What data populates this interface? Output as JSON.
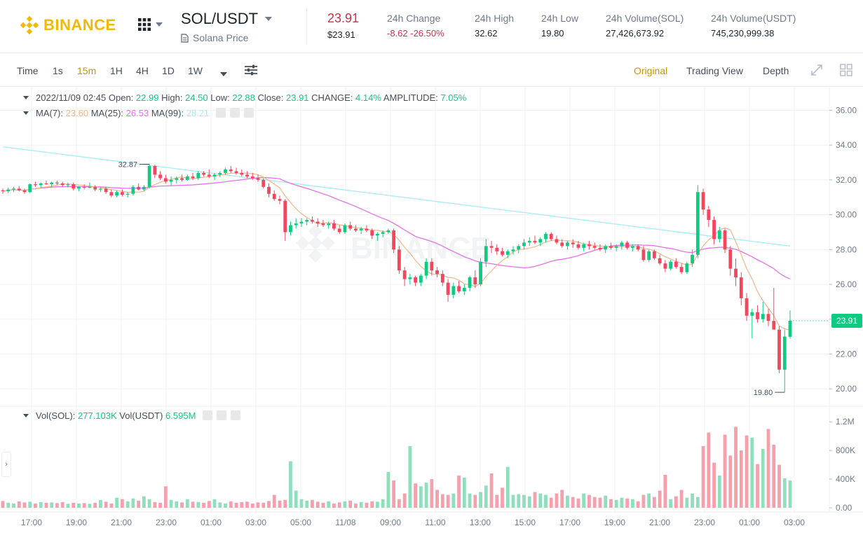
{
  "header": {
    "brand": "BINANCE",
    "pair": "SOL/USDT",
    "pair_subtitle": "Solana Price",
    "last_price": "23.91",
    "last_price_usd": "$23.91",
    "stats": [
      {
        "label": "24h Change",
        "value": "-8.62 -26.50%",
        "down": true
      },
      {
        "label": "24h High",
        "value": "32.62"
      },
      {
        "label": "24h Low",
        "value": "19.80"
      },
      {
        "label": "24h Volume(SOL)",
        "value": "27,426,673.92"
      },
      {
        "label": "24h Volume(USDT)",
        "value": "745,230,999.38"
      }
    ]
  },
  "toolbar": {
    "intervals": [
      "Time",
      "1s",
      "15m",
      "1H",
      "4H",
      "1D",
      "1W"
    ],
    "active_interval": "15m",
    "views": [
      "Original",
      "Trading View",
      "Depth"
    ],
    "active_view": "Original"
  },
  "legend": {
    "datetime": "2022/11/09 02:45",
    "open_label": "Open:",
    "open": "22.99",
    "high_label": "High:",
    "high": "24.50",
    "low_label": "Low:",
    "low": "22.88",
    "close_label": "Close:",
    "close": "23.91",
    "change_label": "CHANGE:",
    "change": "4.14%",
    "amp_label": "AMPLITUDE:",
    "amp": "7.05%",
    "ma7_label": "MA(7):",
    "ma7": "23.60",
    "ma25_label": "MA(25):",
    "ma25": "26.53",
    "ma99_label": "MA(99):",
    "ma99": "28.21",
    "vol_sol_label": "Vol(SOL):",
    "vol_sol": "277.103K",
    "vol_usdt_label": "Vol(USDT)",
    "vol_usdt": "6.595M"
  },
  "colors": {
    "up": "#0ecb81",
    "down": "#f6465d",
    "up_vol": "#8fdfbd",
    "down_vol": "#f5a0ab",
    "ma7": "#f0b68c",
    "ma25": "#e572e6",
    "ma99": "#a8ecf7",
    "accent": "#c99400",
    "brand": "#f0b90b"
  },
  "chart_data": {
    "type": "candlestick",
    "price_axis": {
      "min": 19,
      "max": 36.5,
      "ticks": [
        "36.00",
        "34.00",
        "32.00",
        "30.00",
        "28.00",
        "26.00",
        "24.00",
        "22.00",
        "20.00"
      ]
    },
    "volume_axis": {
      "max": 1300,
      "ticks": [
        "1.2M",
        "800K",
        "400K",
        "0.00"
      ],
      "tick_values": [
        1200,
        800,
        400,
        0
      ]
    },
    "time_ticks": [
      "17:00",
      "19:00",
      "21:00",
      "23:00",
      "01:00",
      "03:00",
      "05:00",
      "11/08",
      "09:00",
      "11:00",
      "13:00",
      "15:00",
      "17:00",
      "19:00",
      "21:00",
      "23:00",
      "01:00",
      "03:00"
    ],
    "current_price_tag": "23.91",
    "high_marker": "32.87",
    "low_marker": "19.80",
    "watermark": "BINANCE",
    "candles": [
      [
        31.4,
        31.5,
        31.2,
        31.35
      ],
      [
        31.35,
        31.55,
        31.25,
        31.45
      ],
      [
        31.45,
        31.6,
        31.3,
        31.5
      ],
      [
        31.5,
        31.65,
        31.35,
        31.4
      ],
      [
        31.4,
        31.5,
        31.2,
        31.3
      ],
      [
        31.3,
        31.8,
        31.25,
        31.75
      ],
      [
        31.75,
        31.9,
        31.6,
        31.7
      ],
      [
        31.7,
        31.85,
        31.55,
        31.8
      ],
      [
        31.8,
        31.95,
        31.7,
        31.75
      ],
      [
        31.75,
        31.9,
        31.6,
        31.85
      ],
      [
        31.85,
        31.95,
        31.7,
        31.8
      ],
      [
        31.8,
        31.9,
        31.6,
        31.7
      ],
      [
        31.7,
        31.85,
        31.55,
        31.75
      ],
      [
        31.75,
        31.85,
        31.4,
        31.5
      ],
      [
        31.5,
        31.65,
        31.35,
        31.6
      ],
      [
        31.6,
        31.75,
        31.45,
        31.55
      ],
      [
        31.55,
        31.85,
        31.5,
        31.6
      ],
      [
        31.6,
        31.7,
        31.35,
        31.45
      ],
      [
        31.45,
        31.6,
        31.3,
        31.5
      ],
      [
        31.5,
        31.6,
        31.2,
        31.3
      ],
      [
        31.3,
        31.45,
        31.0,
        31.1
      ],
      [
        31.1,
        31.4,
        31.0,
        31.3
      ],
      [
        31.3,
        31.45,
        31.05,
        31.15
      ],
      [
        31.15,
        31.3,
        31.0,
        31.2
      ],
      [
        31.2,
        31.7,
        31.1,
        31.6
      ],
      [
        31.6,
        31.8,
        31.4,
        31.45
      ],
      [
        31.45,
        31.7,
        31.35,
        31.6
      ],
      [
        31.6,
        32.9,
        31.5,
        32.8
      ],
      [
        32.8,
        32.87,
        32.1,
        32.3
      ],
      [
        32.3,
        32.5,
        32.0,
        32.1
      ],
      [
        32.1,
        32.3,
        31.8,
        31.9
      ],
      [
        31.9,
        32.2,
        31.7,
        32.0
      ],
      [
        32.0,
        32.2,
        31.8,
        32.1
      ],
      [
        32.1,
        32.3,
        31.9,
        32.0
      ],
      [
        32.0,
        32.3,
        31.95,
        32.2
      ],
      [
        32.2,
        32.4,
        32.0,
        32.1
      ],
      [
        32.1,
        32.5,
        32.0,
        32.4
      ],
      [
        32.4,
        32.5,
        32.2,
        32.3
      ],
      [
        32.3,
        32.6,
        32.1,
        32.2
      ],
      [
        32.2,
        32.4,
        32.0,
        32.3
      ],
      [
        32.3,
        32.5,
        32.15,
        32.4
      ],
      [
        32.4,
        32.7,
        32.3,
        32.6
      ],
      [
        32.6,
        32.8,
        32.4,
        32.5
      ],
      [
        32.5,
        32.7,
        32.3,
        32.4
      ],
      [
        32.4,
        32.6,
        32.2,
        32.3
      ],
      [
        32.3,
        32.5,
        32.1,
        32.2
      ],
      [
        32.2,
        32.4,
        32.0,
        32.1
      ],
      [
        32.1,
        32.3,
        31.9,
        32.0
      ],
      [
        32.0,
        32.1,
        31.5,
        31.6
      ],
      [
        31.6,
        31.8,
        31.0,
        31.2
      ],
      [
        31.2,
        31.4,
        30.8,
        30.9
      ],
      [
        30.9,
        31.1,
        30.6,
        30.8
      ],
      [
        30.8,
        30.9,
        28.5,
        29.0
      ],
      [
        29.0,
        29.6,
        28.8,
        29.4
      ],
      [
        29.4,
        29.8,
        29.2,
        29.5
      ],
      [
        29.5,
        29.8,
        29.3,
        29.6
      ],
      [
        29.6,
        29.8,
        29.4,
        29.7
      ],
      [
        29.7,
        29.9,
        29.5,
        29.6
      ],
      [
        29.6,
        29.8,
        29.3,
        29.5
      ],
      [
        29.5,
        29.7,
        29.3,
        29.4
      ],
      [
        29.4,
        29.6,
        29.2,
        29.5
      ],
      [
        29.5,
        29.7,
        29.1,
        29.2
      ],
      [
        29.2,
        29.4,
        28.9,
        29.0
      ],
      [
        29.0,
        29.5,
        28.9,
        29.4
      ],
      [
        29.4,
        29.6,
        29.1,
        29.2
      ],
      [
        29.2,
        29.4,
        29.0,
        29.1
      ],
      [
        29.1,
        29.3,
        28.9,
        29.2
      ],
      [
        29.2,
        29.4,
        29.0,
        29.1
      ],
      [
        29.1,
        29.2,
        28.6,
        28.8
      ],
      [
        28.8,
        29.0,
        28.5,
        28.9
      ],
      [
        28.9,
        29.1,
        28.7,
        29.0
      ],
      [
        29.0,
        29.2,
        28.9,
        29.1
      ],
      [
        29.1,
        29.2,
        27.8,
        28.0
      ],
      [
        28.0,
        28.2,
        26.6,
        26.8
      ],
      [
        26.8,
        27.0,
        25.9,
        26.3
      ],
      [
        26.3,
        26.6,
        26.0,
        26.4
      ],
      [
        26.4,
        26.5,
        25.9,
        26.1
      ],
      [
        26.1,
        26.6,
        25.9,
        26.5
      ],
      [
        26.5,
        27.5,
        26.3,
        27.3
      ],
      [
        27.3,
        27.5,
        26.5,
        26.8
      ],
      [
        26.8,
        27.0,
        26.4,
        26.6
      ],
      [
        26.6,
        26.8,
        25.9,
        26.1
      ],
      [
        26.1,
        26.3,
        25.0,
        25.4
      ],
      [
        25.4,
        26.1,
        25.2,
        25.9
      ],
      [
        25.9,
        26.2,
        25.5,
        25.6
      ],
      [
        25.6,
        26.0,
        25.4,
        25.8
      ],
      [
        25.8,
        26.5,
        25.6,
        26.4
      ],
      [
        26.4,
        26.8,
        25.8,
        26.0
      ],
      [
        26.0,
        27.5,
        25.9,
        27.3
      ],
      [
        27.3,
        28.6,
        27.0,
        28.2
      ],
      [
        28.2,
        28.5,
        27.8,
        28.1
      ],
      [
        28.1,
        28.3,
        27.7,
        27.9
      ],
      [
        27.9,
        28.1,
        27.6,
        27.7
      ],
      [
        27.7,
        28.0,
        27.5,
        27.9
      ],
      [
        27.9,
        28.2,
        27.7,
        28.0
      ],
      [
        28.0,
        28.3,
        27.8,
        28.2
      ],
      [
        28.2,
        28.6,
        28.0,
        28.4
      ],
      [
        28.4,
        28.7,
        28.2,
        28.5
      ],
      [
        28.5,
        28.8,
        28.3,
        28.4
      ],
      [
        28.4,
        28.7,
        28.2,
        28.6
      ],
      [
        28.6,
        29.0,
        28.4,
        28.9
      ],
      [
        28.9,
        29.0,
        28.5,
        28.6
      ],
      [
        28.6,
        28.8,
        28.3,
        28.4
      ],
      [
        28.4,
        28.6,
        28.1,
        28.2
      ],
      [
        28.2,
        28.5,
        28.0,
        28.4
      ],
      [
        28.4,
        28.6,
        28.1,
        28.3
      ],
      [
        28.3,
        28.5,
        28.0,
        28.1
      ],
      [
        28.1,
        28.4,
        27.9,
        28.3
      ],
      [
        28.3,
        28.5,
        28.0,
        28.2
      ],
      [
        28.2,
        28.4,
        28.0,
        28.1
      ],
      [
        28.1,
        28.3,
        27.9,
        28.0
      ],
      [
        28.0,
        28.3,
        27.8,
        28.2
      ],
      [
        28.2,
        28.4,
        28.0,
        28.1
      ],
      [
        28.1,
        28.3,
        27.9,
        28.2
      ],
      [
        28.2,
        28.5,
        28.0,
        28.4
      ],
      [
        28.4,
        28.5,
        28.0,
        28.1
      ],
      [
        28.1,
        28.3,
        27.9,
        28.2
      ],
      [
        28.2,
        28.3,
        27.9,
        28.0
      ],
      [
        28.0,
        28.2,
        27.3,
        27.4
      ],
      [
        27.4,
        28.0,
        27.3,
        27.9
      ],
      [
        27.9,
        28.0,
        27.4,
        27.5
      ],
      [
        27.5,
        27.7,
        27.1,
        27.2
      ],
      [
        27.2,
        27.4,
        26.7,
        26.9
      ],
      [
        26.9,
        27.4,
        26.8,
        27.3
      ],
      [
        27.3,
        27.5,
        26.9,
        27.0
      ],
      [
        27.0,
        27.2,
        26.6,
        26.7
      ],
      [
        26.7,
        27.3,
        26.6,
        27.2
      ],
      [
        27.2,
        28.0,
        27.0,
        27.7
      ],
      [
        27.7,
        31.7,
        27.5,
        31.3
      ],
      [
        31.3,
        31.5,
        30.0,
        30.3
      ],
      [
        30.3,
        30.5,
        29.3,
        29.7
      ],
      [
        29.7,
        29.9,
        28.3,
        28.6
      ],
      [
        28.6,
        29.3,
        28.4,
        29.1
      ],
      [
        29.1,
        29.2,
        27.8,
        28.0
      ],
      [
        28.0,
        28.2,
        26.5,
        26.9
      ],
      [
        26.9,
        27.5,
        25.9,
        26.4
      ],
      [
        26.4,
        26.7,
        24.8,
        25.2
      ],
      [
        25.2,
        25.5,
        23.9,
        24.2
      ],
      [
        24.2,
        24.6,
        22.9,
        24.4
      ],
      [
        24.4,
        24.8,
        23.8,
        24.0
      ],
      [
        24.0,
        25.0,
        23.8,
        24.3
      ],
      [
        24.3,
        24.6,
        23.6,
        23.9
      ],
      [
        23.9,
        25.8,
        23.7,
        23.4
      ],
      [
        23.4,
        23.6,
        20.9,
        21.1
      ],
      [
        21.1,
        23.4,
        19.8,
        23.0
      ],
      [
        22.99,
        24.5,
        22.88,
        23.91
      ]
    ],
    "volumes_k": [
      95,
      70,
      60,
      90,
      75,
      85,
      60,
      80,
      70,
      75,
      65,
      80,
      55,
      70,
      60,
      65,
      55,
      70,
      110,
      85,
      60,
      140,
      120,
      90,
      130,
      100,
      160,
      120,
      80,
      70,
      300,
      110,
      90,
      75,
      120,
      85,
      80,
      70,
      95,
      120,
      75,
      60,
      90,
      70,
      80,
      85,
      60,
      75,
      70,
      95,
      180,
      100,
      110,
      650,
      240,
      120,
      100,
      110,
      85,
      70,
      90,
      60,
      75,
      90,
      100,
      60,
      80,
      70,
      90,
      85,
      120,
      500,
      380,
      120,
      200,
      860,
      340,
      300,
      350,
      400,
      250,
      190,
      180,
      200,
      450,
      420,
      200,
      180,
      220,
      310,
      480,
      180,
      280,
      570,
      180,
      190,
      180,
      160,
      220,
      200,
      180,
      140,
      200,
      250,
      170,
      150,
      130,
      200,
      180,
      150,
      140,
      170,
      120,
      110,
      140,
      130,
      120,
      90,
      180,
      200,
      150,
      240,
      460,
      120,
      160,
      250,
      140,
      200,
      150,
      860,
      1050,
      630,
      450,
      1020,
      730,
      1130,
      800,
      1010,
      980,
      610,
      820,
      1100,
      880,
      600,
      410,
      380,
      1260,
      280
    ]
  }
}
